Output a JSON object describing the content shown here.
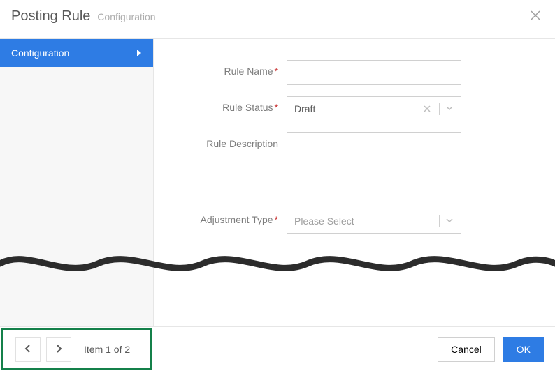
{
  "header": {
    "title": "Posting Rule",
    "subtitle": "Configuration"
  },
  "sidebar": {
    "items": [
      {
        "label": "Configuration"
      }
    ]
  },
  "form": {
    "rule_name": {
      "label": "Rule Name",
      "value": ""
    },
    "rule_status": {
      "label": "Rule Status",
      "value": "Draft"
    },
    "rule_description": {
      "label": "Rule Description",
      "value": ""
    },
    "adjustment_type": {
      "label": "Adjustment Type",
      "value": "Please Select"
    }
  },
  "pager": {
    "label": "Item 1 of 2"
  },
  "footer": {
    "cancel": "Cancel",
    "ok": "OK"
  }
}
